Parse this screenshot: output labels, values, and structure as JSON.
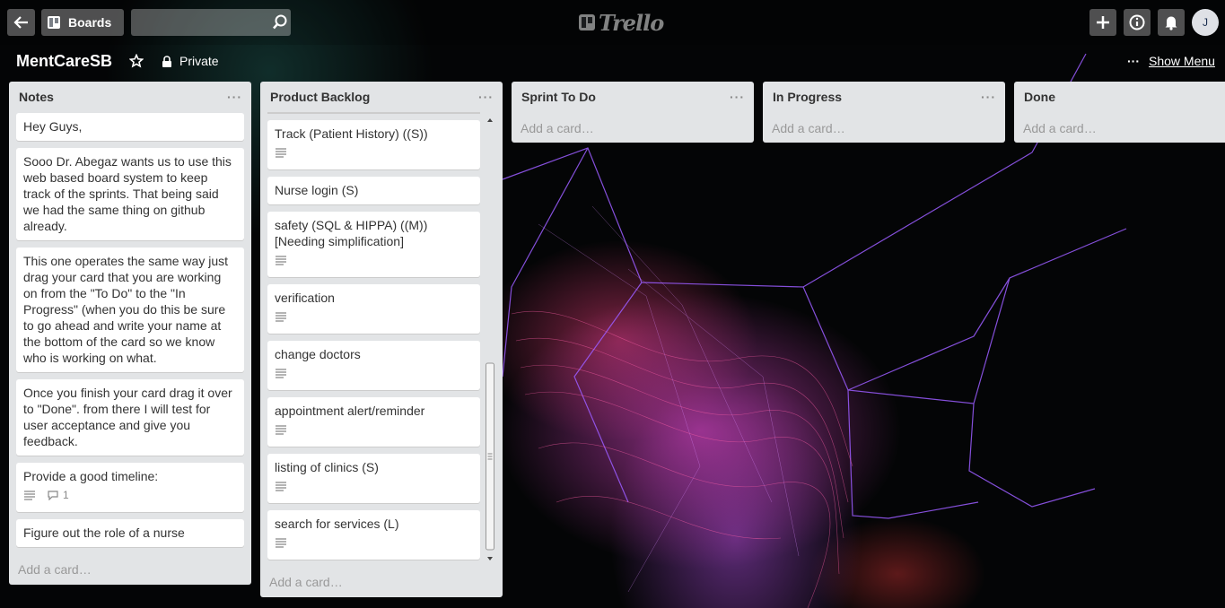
{
  "header": {
    "boards_label": "Boards",
    "search_placeholder": "",
    "logo_text": "Trello",
    "avatar_initial": "J"
  },
  "board": {
    "title": "MentCareSB",
    "visibility": "Private",
    "show_menu_label": "Show Menu",
    "menu_dots": "···"
  },
  "lists": [
    {
      "title": "Notes",
      "add_card": "Add a card…",
      "cards": [
        {
          "text": "Hey Guys,"
        },
        {
          "text": "Sooo Dr. Abegaz wants us to use this web based board system to keep track of the sprints. That being said we had the same thing on github already."
        },
        {
          "text": "This one operates the same way just drag your card that you are working on from the \"To Do\" to the \"In Progress\" (when you do this be sure to go ahead and write your name at the bottom of the card so we know who is working on what."
        },
        {
          "text": "Once you finish your card drag it over to \"Done\". from there I will test for user acceptance and give you feedback."
        },
        {
          "text": "Provide a good timeline:",
          "comments": "1"
        },
        {
          "text": "Figure out the role of a nurse"
        }
      ]
    },
    {
      "title": "Product Backlog",
      "add_card": "Add a card…",
      "cards": [
        {
          "text": "Track (Patient History) ((S))"
        },
        {
          "text": "Nurse login (S)"
        },
        {
          "text": "safety (SQL & HIPPA) ((M)) [Needing simplification]"
        },
        {
          "text": "verification"
        },
        {
          "text": "change doctors"
        },
        {
          "text": "appointment alert/reminder"
        },
        {
          "text": "listing of clinics (S)"
        },
        {
          "text": "search for services (L)"
        }
      ]
    },
    {
      "title": "Sprint To Do",
      "add_card": "Add a card…"
    },
    {
      "title": "In Progress",
      "add_card": "Add a card…"
    },
    {
      "title": "Done",
      "add_card": "Add a card…"
    }
  ],
  "colors": {
    "header_button": "#ffffff4d",
    "list_bg": "#e2e4e6",
    "card_bg": "#ffffff"
  }
}
